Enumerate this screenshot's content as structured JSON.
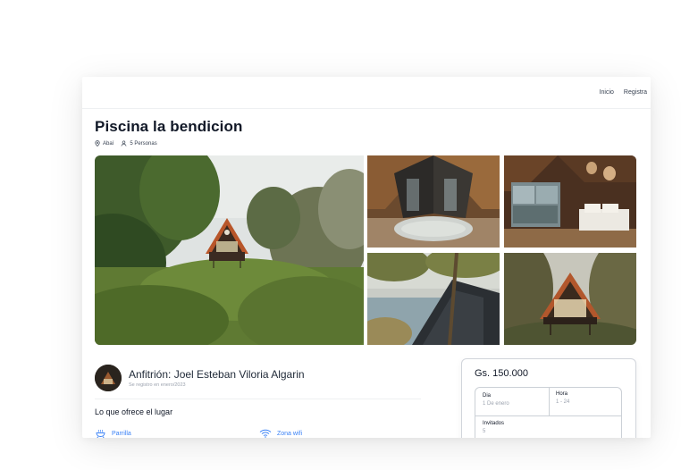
{
  "nav": {
    "inicio": "Inicio",
    "registra": "Registra"
  },
  "listing": {
    "title": "Piscina la bendicion",
    "location": "Abaí",
    "capacity": "5 Personas"
  },
  "host": {
    "name": "Anfitrión: Joel Esteban Viloria Algarin",
    "since": "Se registro en enero/2023"
  },
  "offers": {
    "title": "Lo que ofrece el lugar",
    "items": [
      {
        "label": "Parrilla",
        "icon": "grill-icon"
      },
      {
        "label": "Zona wifi",
        "icon": "wifi-icon"
      }
    ]
  },
  "booking": {
    "price": "Gs. 150.000",
    "dia_label": "Dia",
    "dia_value": "1 De enero",
    "hora_label": "Hora",
    "hora_value": "1 - 24",
    "invitados_label": "Invitados",
    "invitados_value": "5"
  },
  "colors": {
    "accent": "#3b82f6",
    "text": "#111827",
    "muted": "#9ca3af"
  }
}
